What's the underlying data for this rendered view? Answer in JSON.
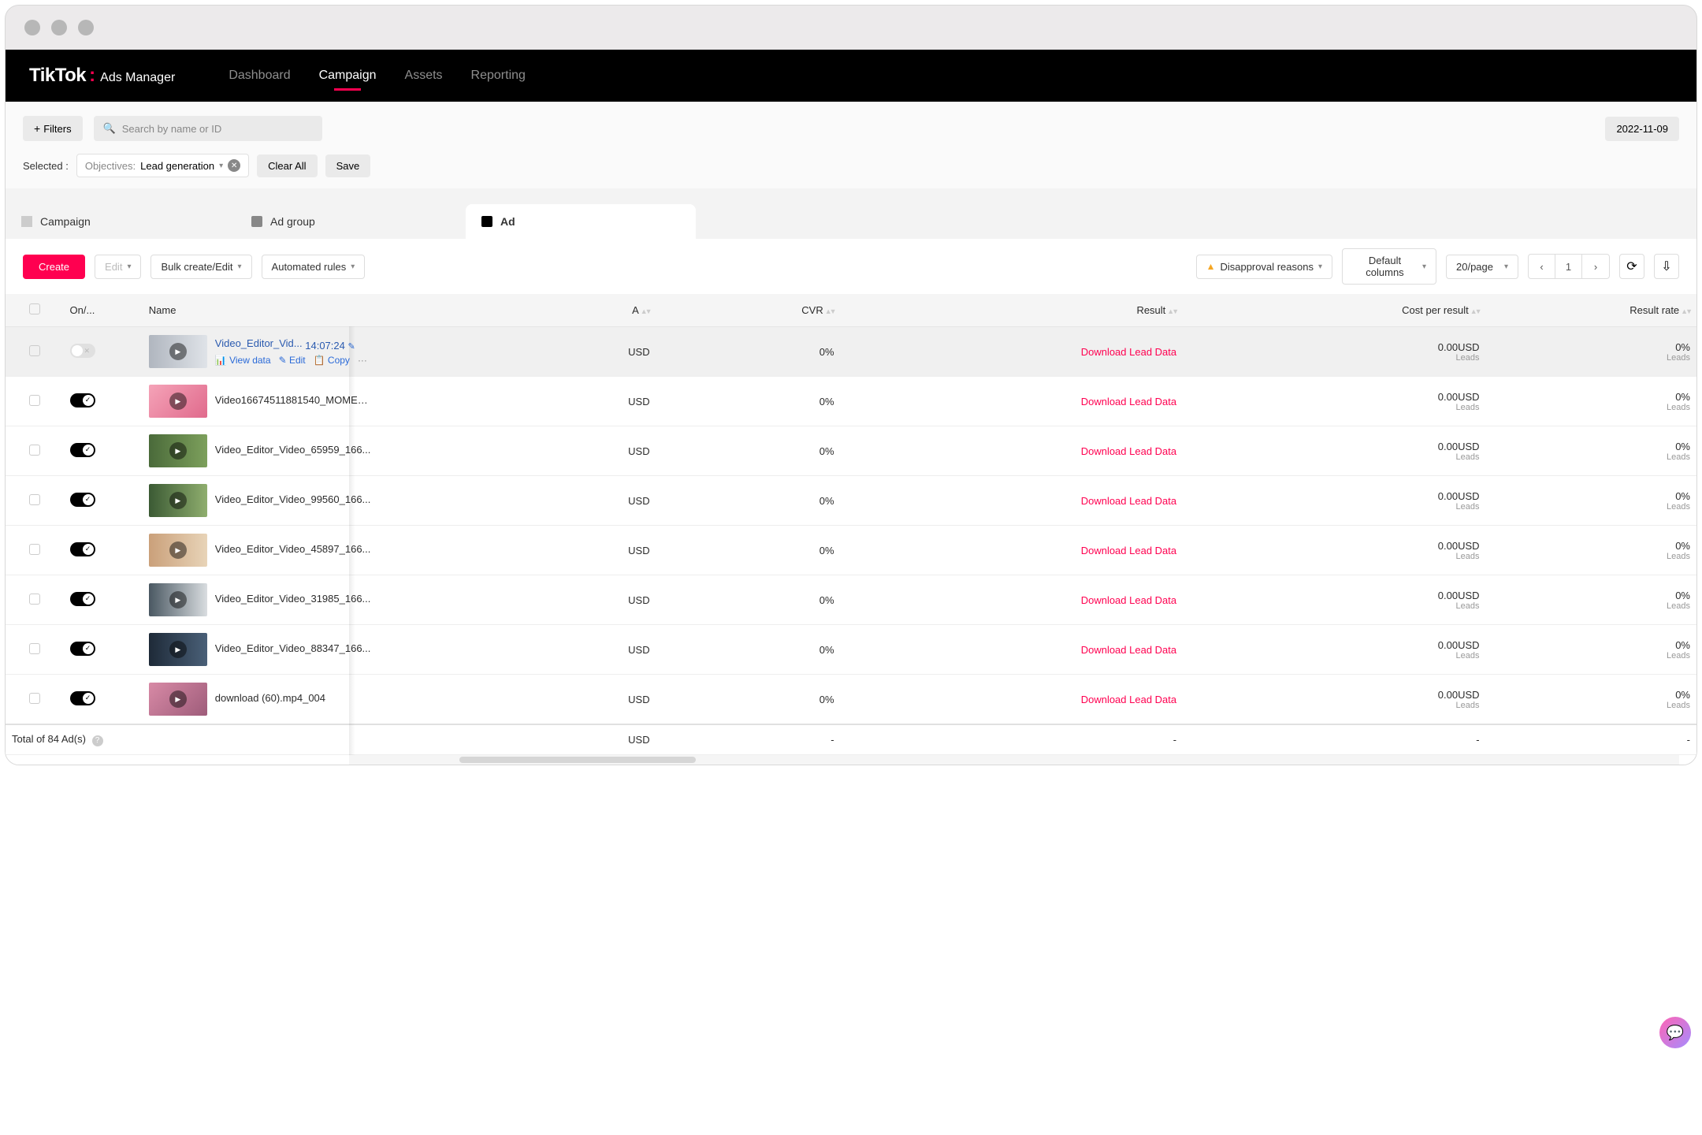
{
  "brand": {
    "name": "TikTok",
    "suffix": "Ads Manager",
    "colon": ":"
  },
  "nav": {
    "items": [
      "Dashboard",
      "Campaign",
      "Assets",
      "Reporting"
    ],
    "active": "Campaign"
  },
  "filters": {
    "button": "Filters",
    "plus": "+",
    "search_placeholder": "Search by name or ID",
    "date": "2022-11-09",
    "selected_label": "Selected :",
    "chip_key": "Objectives:",
    "chip_val": "Lead generation",
    "clear": "Clear All",
    "save": "Save"
  },
  "levels": {
    "campaign": "Campaign",
    "adgroup": "Ad group",
    "ad": "Ad"
  },
  "toolbar": {
    "create": "Create",
    "edit": "Edit",
    "bulk": "Bulk create/Edit",
    "rules": "Automated rules",
    "disapproval": "Disapproval reasons",
    "columns": "Default columns",
    "page_size": "20/page",
    "page": "1"
  },
  "table": {
    "headers": {
      "on": "On/...",
      "name": "Name",
      "a": "A",
      "cvr": "CVR",
      "result": "Result",
      "cpr": "Cost per result",
      "rr": "Result rate"
    },
    "usd_frag": "USD",
    "download": "Download Lead Data",
    "leads": "Leads",
    "actions": {
      "view": "View data",
      "edit": "Edit",
      "copy": "Copy",
      "more": "···"
    },
    "totals_label": "Total of 84 Ad(s)",
    "rows": [
      {
        "name": "Video_Editor_Vid...",
        "timestamp": "14:07:24",
        "highlight": true,
        "on": false,
        "cvr": "0%",
        "cpr": "0.00USD",
        "rr": "0%",
        "thumb": "linear-gradient(90deg,#b0b6bf,#dfe3e8)"
      },
      {
        "name": "Video16674511881540_MOMENT...",
        "on": true,
        "cvr": "0%",
        "cpr": "0.00USD",
        "rr": "0%",
        "thumb": "linear-gradient(135deg,#f5a3b8,#e06a8c)"
      },
      {
        "name": "Video_Editor_Video_65959_166...",
        "on": true,
        "cvr": "0%",
        "cpr": "0.00USD",
        "rr": "0%",
        "thumb": "linear-gradient(90deg,#4a6a3a,#7da05c)"
      },
      {
        "name": "Video_Editor_Video_99560_166...",
        "on": true,
        "cvr": "0%",
        "cpr": "0.00USD",
        "rr": "0%",
        "thumb": "linear-gradient(90deg,#3b5a34,#8fae6e)"
      },
      {
        "name": "Video_Editor_Video_45897_166...",
        "on": true,
        "cvr": "0%",
        "cpr": "0.00USD",
        "rr": "0%",
        "thumb": "linear-gradient(90deg,#caa07a,#e8d4b8)"
      },
      {
        "name": "Video_Editor_Video_31985_166...",
        "on": true,
        "cvr": "0%",
        "cpr": "0.00USD",
        "rr": "0%",
        "thumb": "linear-gradient(90deg,#4a5862,#d9dde0)"
      },
      {
        "name": "Video_Editor_Video_88347_166...",
        "on": true,
        "cvr": "0%",
        "cpr": "0.00USD",
        "rr": "0%",
        "thumb": "linear-gradient(90deg,#1e2a38,#4a6078)"
      },
      {
        "name": "download (60).mp4_004",
        "on": true,
        "cvr": "0%",
        "cpr": "0.00USD",
        "rr": "0%",
        "thumb": "linear-gradient(135deg,#d88aa6,#9e5c7a)"
      }
    ],
    "totals": {
      "a": "USD",
      "cvr": "-",
      "result": "-",
      "cpr": "-",
      "rr": "-"
    }
  }
}
